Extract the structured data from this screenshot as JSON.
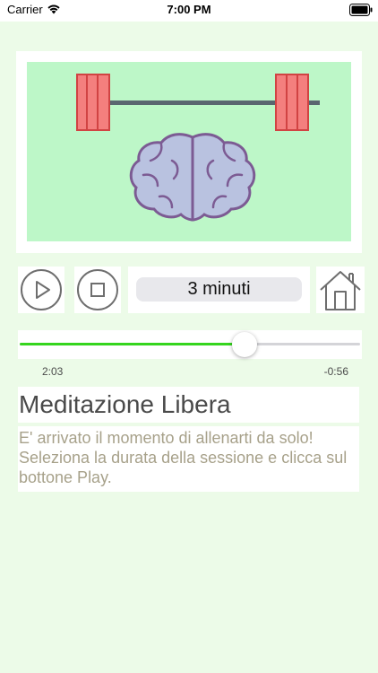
{
  "status_bar": {
    "carrier": "Carrier",
    "time": "7:00 PM"
  },
  "hero": {
    "icons": [
      "barbell-icon",
      "brain-icon"
    ]
  },
  "controls": {
    "play_icon": "play-icon",
    "stop_icon": "stop-icon",
    "duration_value": "3 minuti",
    "home_icon": "home-icon"
  },
  "progress": {
    "fraction": 0.66,
    "elapsed": "2:03",
    "remaining": "-0:56"
  },
  "content": {
    "title": "Meditazione Libera",
    "description": "E' arrivato il momento di allenarti da solo! Seleziona la durata della sessione e clicca sul bottone Play."
  },
  "colors": {
    "background": "#ecfbe8",
    "art_background": "#bdf7c8",
    "weight_plates": "#f47f7e",
    "brain": "#b9c2e0",
    "brain_outline": "#7c5b93",
    "progress_fill": "#35d51e",
    "description_text": "#a7a18a"
  }
}
